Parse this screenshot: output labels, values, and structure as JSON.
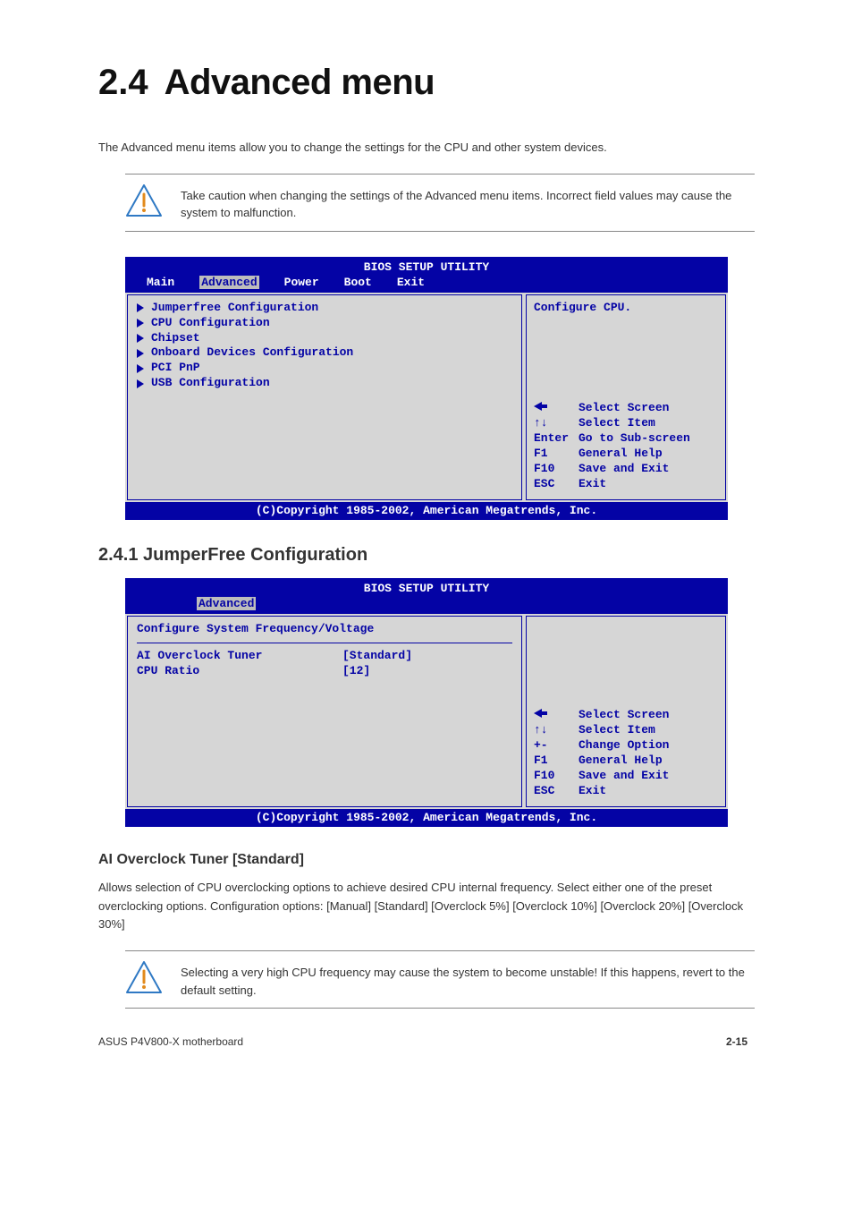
{
  "heading": {
    "number": "2.4",
    "title": "Advanced menu"
  },
  "intro_para": "The Advanced menu items allow you to change the settings for the CPU and other system devices.",
  "warning1": "Take caution when changing the settings of the Advanced menu items. Incorrect field values may cause the system to malfunction.",
  "bios1": {
    "title": "BIOS SETUP UTILITY",
    "tabs": [
      "Main",
      "Advanced",
      "Power",
      "Boot",
      "Exit"
    ],
    "active_tab": "Advanced",
    "menu_items": [
      "Jumperfree Configuration",
      "CPU Configuration",
      "Chipset",
      "Onboard Devices Configuration",
      "PCI PnP",
      "USB Configuration"
    ],
    "help_top": "Configure CPU.",
    "keys": [
      {
        "k": "←",
        "v": "Select Screen"
      },
      {
        "k": "↑↓",
        "v": "Select Item"
      },
      {
        "k": "Enter",
        "v": "Go to Sub-screen"
      },
      {
        "k": "F1",
        "v": "General Help"
      },
      {
        "k": "F10",
        "v": "Save and Exit"
      },
      {
        "k": "ESC",
        "v": "Exit"
      }
    ],
    "footer": "(C)Copyright 1985-2002, American Megatrends, Inc."
  },
  "subhead_l2": "2.4.1 JumperFree Configuration",
  "bios2": {
    "title": "BIOS SETUP UTILITY",
    "tabs": [
      "Advanced"
    ],
    "active_tab": "Advanced",
    "section_title": "Configure System Frequency/Voltage",
    "rows": [
      {
        "k": "AI Overclock Tuner",
        "v": "[Standard]"
      },
      {
        "k": "CPU Ratio",
        "v": "[12]"
      }
    ],
    "help_top": "",
    "keys": [
      {
        "k": "←",
        "v": "Select Screen"
      },
      {
        "k": "↑↓",
        "v": "Select Item"
      },
      {
        "k": "+-",
        "v": "Change Option"
      },
      {
        "k": "F1",
        "v": "General Help"
      },
      {
        "k": "F10",
        "v": "Save and Exit"
      },
      {
        "k": "ESC",
        "v": "Exit"
      }
    ],
    "footer": "(C)Copyright 1985-2002, American Megatrends, Inc."
  },
  "subhead_l3": "AI Overclock Tuner [Standard]",
  "ai_para": "Allows selection of CPU overclocking options to achieve desired CPU internal frequency. Select either one of the preset overclocking options. Configuration options: [Manual] [Standard] [Overclock 5%] [Overclock 10%] [Overclock 20%] [Overclock 30%]",
  "warning2": "Selecting a very high CPU frequency may cause the system to become unstable! If this happens, revert to the default setting.",
  "footer": {
    "left": "ASUS P4V800-X motherboard",
    "right_num": "2-15"
  }
}
